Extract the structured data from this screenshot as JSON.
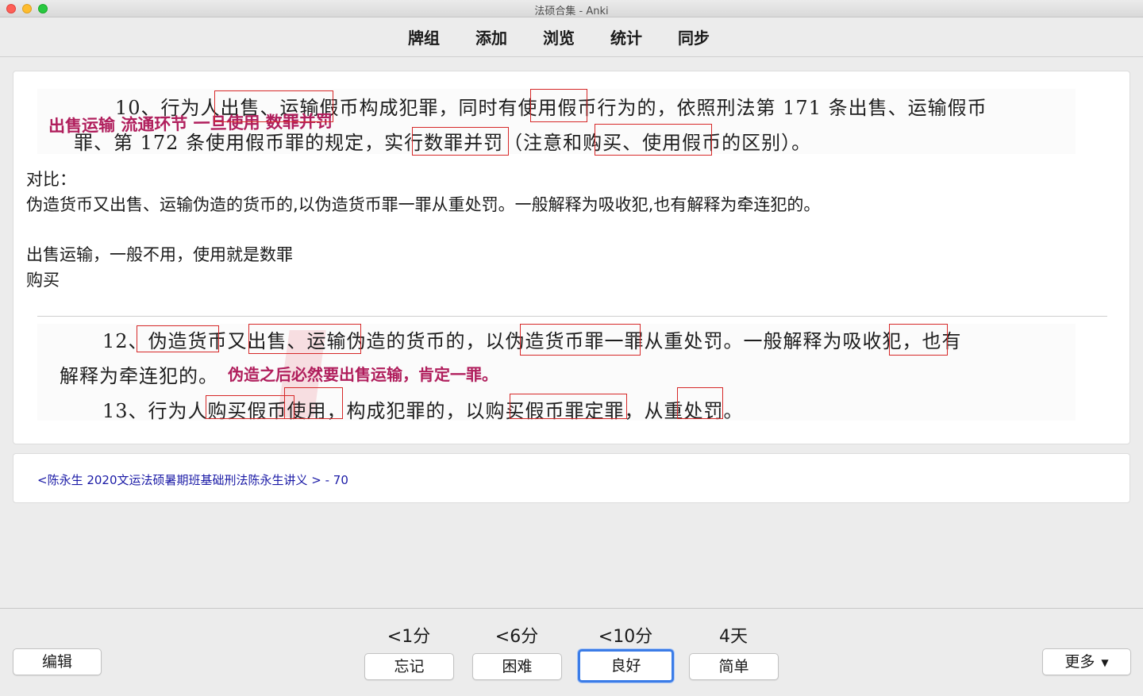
{
  "window": {
    "title": "法硕合集 - Anki"
  },
  "toolbar": {
    "items": [
      "牌组",
      "添加",
      "浏览",
      "统计",
      "同步"
    ]
  },
  "card": {
    "scan1": {
      "line1": "10、行为人出售、运输假币构成犯罪，同时有使用假币行为的，依照刑法第 171 条出售、运输假币",
      "line2": "罪、第 172 条使用假币罪的规定，实行数罪并罚（注意和购买、使用假币的区别）。",
      "annotation": "出售运输 流通环节 一旦使用 数罪并罚"
    },
    "compare_label": "对比：",
    "compare_text": "伪造货币又出售、运输伪造的货币的,以伪造货币罪一罪从重处罚。一般解释为吸收犯,也有解释为牵连犯的。",
    "note_line1": "出售运输，一般不用，使用就是数罪",
    "note_line2": "购买",
    "scan2": {
      "line1": "12、伪造货币又出售、运输伪造的货币的，以伪造货币罪一罪从重处罚。一般解释为吸收犯，也有",
      "line2_prefix": "解释为牵连犯的。",
      "line2_annotation": "伪造之后必然要出售运输，肯定一罪。",
      "line3": "13、行为人购买假币使用，构成犯罪的，以购买假币罪定罪，从重处罚。"
    }
  },
  "source": {
    "text": "<陈永生 2020文运法硕暑期班基础刑法陈永生讲义 > - 70"
  },
  "bottom": {
    "edit_label": "编辑",
    "more_label": "更多",
    "answers": [
      {
        "interval": "<1分",
        "label": "忘记"
      },
      {
        "interval": "<6分",
        "label": "困难"
      },
      {
        "interval": "<10分",
        "label": "良好"
      },
      {
        "interval": "4天",
        "label": "简单"
      }
    ]
  },
  "colors": {
    "highlight_box": "#d62828",
    "annotation": "#b01e5c",
    "link": "#1a1aa6",
    "focus_ring": "#3b7ce7"
  }
}
